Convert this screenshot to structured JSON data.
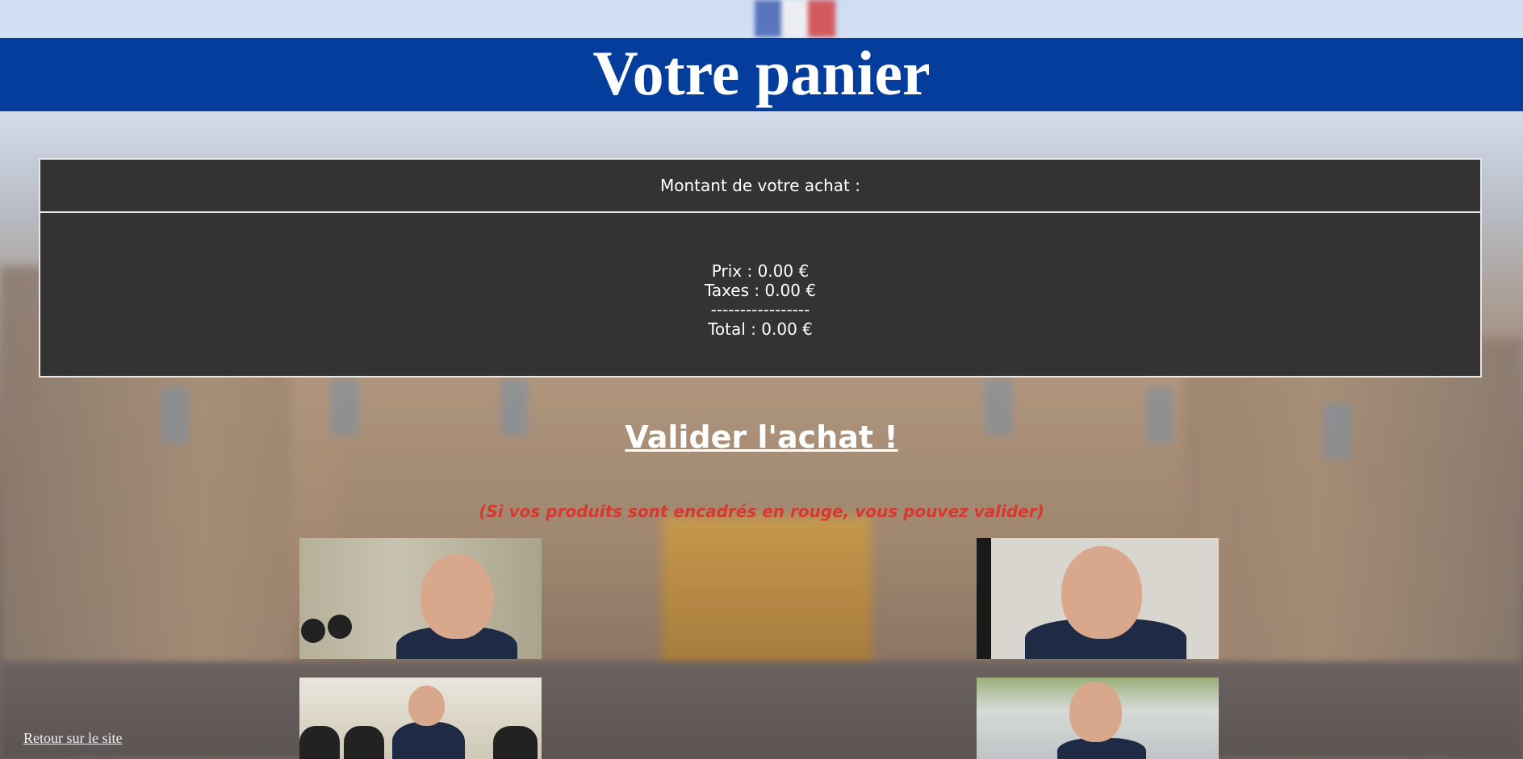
{
  "header": {
    "title": "Votre panier"
  },
  "summary": {
    "heading": "Montant de votre achat :",
    "price_line": "Prix : 0.00 €",
    "taxes_line": "Taxes : 0.00 €",
    "separator": "-----------------",
    "total_line": "Total : 0.00 €"
  },
  "actions": {
    "validate_label": "Valider l'achat !",
    "hint": "(Si vos produits sont encadrés en rouge, vous pouvez valider)",
    "back_label": "Retour sur le site"
  },
  "colors": {
    "header_bg": "#053d9c",
    "box_bg": "#333333",
    "hint_color": "#d8382e"
  }
}
